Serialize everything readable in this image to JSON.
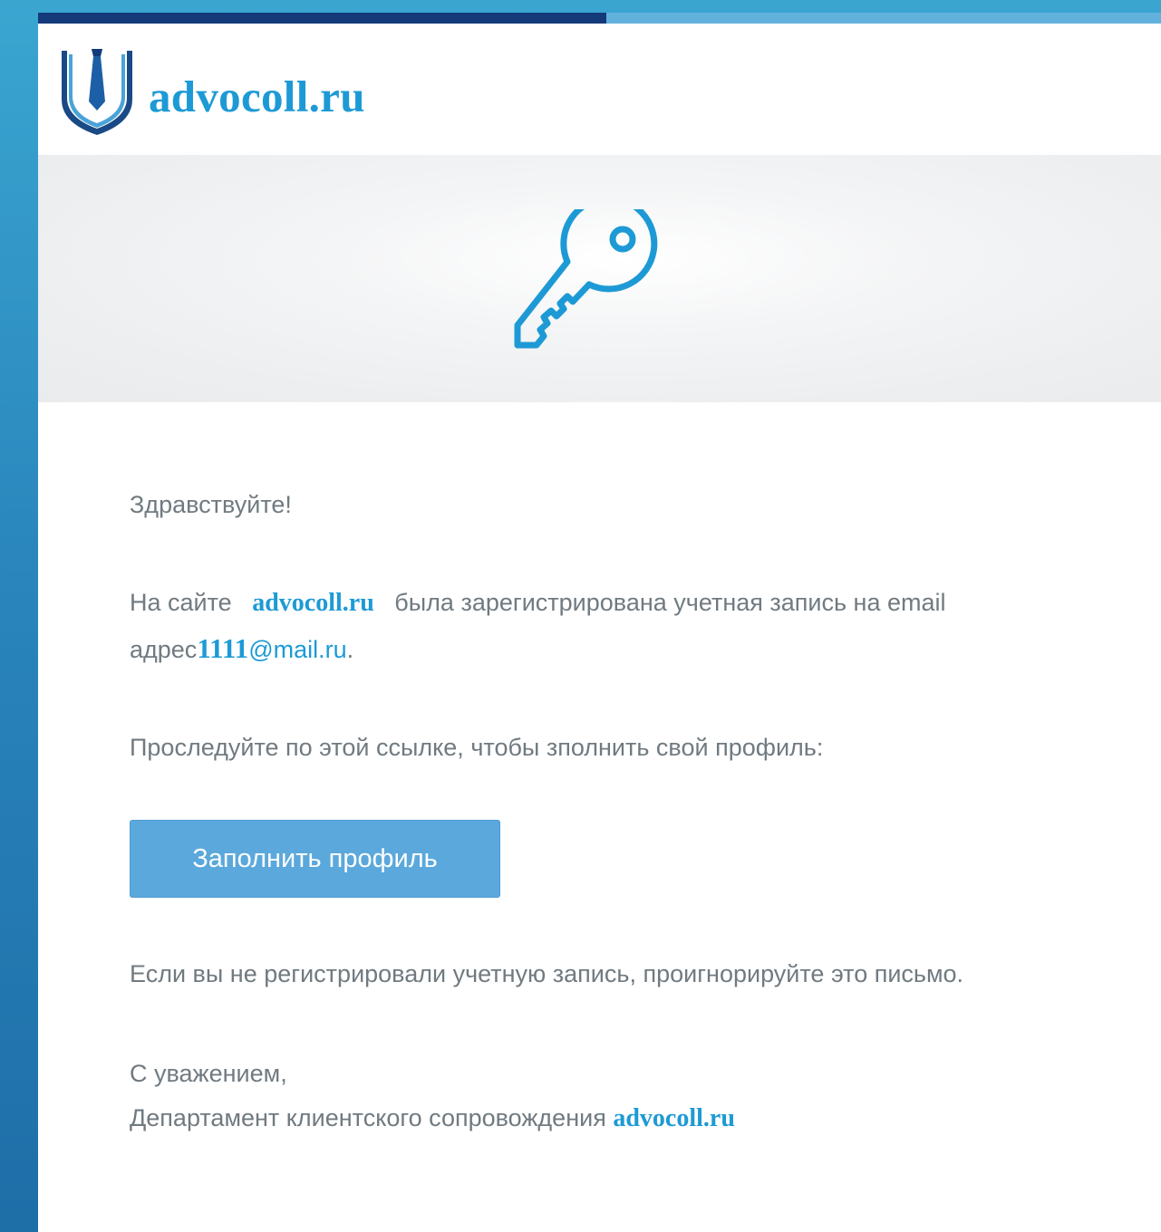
{
  "header": {
    "logo_text": "advocoll.ru"
  },
  "greeting": "Здравствуйте!",
  "registration": {
    "prefix": "На сайте",
    "site": "advocoll.ru",
    "middle": "была зарегистрирована учетная запись на email",
    "address_label": "адрес",
    "email_user": "1111",
    "email_domain": "@mail.ru",
    "period": "."
  },
  "instruction": "Проследуйте по этой ссылке, чтобы зполнить свой профиль:",
  "cta": {
    "label": "Заполнить профиль"
  },
  "ignore_note": "Если вы не регистрировали учетную запись, проигнорируйте это письмо.",
  "signature": {
    "regards": "С уважением,",
    "department": "Департамент клиентского сопровождения",
    "site": "advocoll.ru"
  },
  "icons": {
    "logo": "shield-tie-icon",
    "hero": "key-icon"
  },
  "colors": {
    "brand_blue": "#1d9ad5",
    "dark_navy": "#143a7a",
    "button_blue": "#5ba8dc",
    "body_text": "#707a80"
  }
}
